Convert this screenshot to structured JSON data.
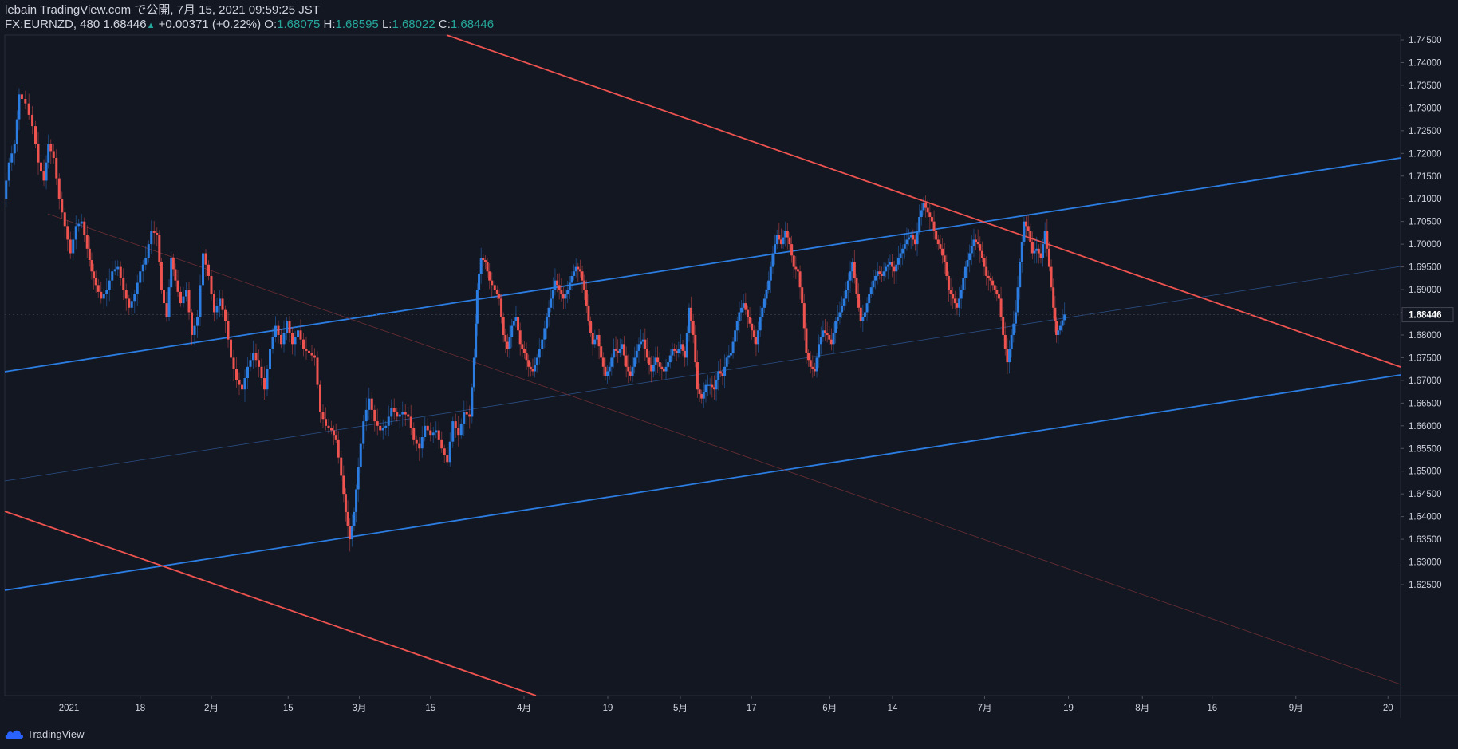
{
  "header": {
    "publisher": "lebain TradingView.com で公開, 7月 15, 2021 09:59:25 JST",
    "symbol": "FX:EURNZD, 480",
    "last": "1.68446",
    "change_arrow": "▲",
    "change": "+0.00371 (+0.22%)",
    "o_label": "O:",
    "o": "1.68075",
    "h_label": "H:",
    "h": "1.68595",
    "l_label": "L:",
    "l": "1.68022",
    "c_label": "C:",
    "c": "1.68446"
  },
  "footer": {
    "brand": "TradingView",
    "logo_icon": "tradingview-cloud-icon"
  },
  "colors": {
    "background": "#131722",
    "up": "#2b7de2",
    "down": "#ef5350",
    "blue_line": "#2b7de2",
    "red_line": "#ef5350",
    "axis_text": "#d1d4dc",
    "price_tag_bg": "#131722"
  },
  "chart_data": {
    "type": "candlestick",
    "ylim": [
      1.6225,
      1.7475
    ],
    "price_ticks": [
      "1.74500",
      "1.74000",
      "1.73500",
      "1.73000",
      "1.72500",
      "1.72000",
      "1.71500",
      "1.71000",
      "1.70500",
      "1.70000",
      "1.69500",
      "1.69000",
      "1.68500",
      "1.68000",
      "1.67500",
      "1.67000",
      "1.66500",
      "1.66000",
      "1.65500",
      "1.65000",
      "1.64500",
      "1.64000",
      "1.63500",
      "1.63000",
      "1.62500"
    ],
    "current_price": "1.68446",
    "x_ticks": [
      {
        "label": "2021",
        "t": 0.046
      },
      {
        "label": "18",
        "t": 0.097
      },
      {
        "label": "2月",
        "t": 0.148
      },
      {
        "label": "15",
        "t": 0.203
      },
      {
        "label": "3月",
        "t": 0.254
      },
      {
        "label": "15",
        "t": 0.305
      },
      {
        "label": "4月",
        "t": 0.372
      },
      {
        "label": "19",
        "t": 0.432
      },
      {
        "label": "5月",
        "t": 0.484
      },
      {
        "label": "17",
        "t": 0.535
      },
      {
        "label": "6月",
        "t": 0.591
      },
      {
        "label": "14",
        "t": 0.636
      },
      {
        "label": "7月",
        "t": 0.702
      },
      {
        "label": "19",
        "t": 0.762
      },
      {
        "label": "8月",
        "t": 0.815
      },
      {
        "label": "16",
        "t": 0.865
      },
      {
        "label": "9月",
        "t": 0.925
      },
      {
        "label": "20",
        "t": 0.991
      }
    ],
    "price_path": [
      [
        0,
        1.71
      ],
      [
        0.004,
        1.718
      ],
      [
        0.008,
        1.722
      ],
      [
        0.011,
        1.733
      ],
      [
        0.016,
        1.731
      ],
      [
        0.021,
        1.726
      ],
      [
        0.025,
        1.718
      ],
      [
        0.029,
        1.714
      ],
      [
        0.032,
        1.722
      ],
      [
        0.036,
        1.719
      ],
      [
        0.04,
        1.71
      ],
      [
        0.044,
        1.704
      ],
      [
        0.048,
        1.698
      ],
      [
        0.052,
        1.704
      ],
      [
        0.056,
        1.705
      ],
      [
        0.06,
        1.699
      ],
      [
        0.063,
        1.694
      ],
      [
        0.066,
        1.691
      ],
      [
        0.07,
        1.688
      ],
      [
        0.074,
        1.69
      ],
      [
        0.078,
        1.694
      ],
      [
        0.082,
        1.695
      ],
      [
        0.086,
        1.69
      ],
      [
        0.09,
        1.686
      ],
      [
        0.094,
        1.689
      ],
      [
        0.098,
        1.694
      ],
      [
        0.102,
        1.697
      ],
      [
        0.106,
        1.703
      ],
      [
        0.11,
        1.702
      ],
      [
        0.113,
        1.69
      ],
      [
        0.117,
        1.684
      ],
      [
        0.12,
        1.697
      ],
      [
        0.123,
        1.692
      ],
      [
        0.127,
        1.687
      ],
      [
        0.131,
        1.69
      ],
      [
        0.135,
        1.68
      ],
      [
        0.139,
        1.684
      ],
      [
        0.143,
        1.698
      ],
      [
        0.147,
        1.693
      ],
      [
        0.151,
        1.685
      ],
      [
        0.155,
        1.688
      ],
      [
        0.159,
        1.683
      ],
      [
        0.163,
        1.675
      ],
      [
        0.167,
        1.67
      ],
      [
        0.171,
        1.668
      ],
      [
        0.175,
        1.673
      ],
      [
        0.179,
        1.676
      ],
      [
        0.183,
        1.673
      ],
      [
        0.187,
        1.668
      ],
      [
        0.191,
        1.677
      ],
      [
        0.195,
        1.682
      ],
      [
        0.199,
        1.678
      ],
      [
        0.203,
        1.683
      ],
      [
        0.207,
        1.678
      ],
      [
        0.211,
        1.681
      ],
      [
        0.215,
        1.677
      ],
      [
        0.219,
        1.676
      ],
      [
        0.223,
        1.675
      ],
      [
        0.227,
        1.663
      ],
      [
        0.231,
        1.66
      ],
      [
        0.235,
        1.659
      ],
      [
        0.238,
        1.657
      ],
      [
        0.242,
        1.649
      ],
      [
        0.245,
        1.641
      ],
      [
        0.248,
        1.635
      ],
      [
        0.251,
        1.641
      ],
      [
        0.254,
        1.651
      ],
      [
        0.258,
        1.661
      ],
      [
        0.262,
        1.666
      ],
      [
        0.266,
        1.661
      ],
      [
        0.27,
        1.659
      ],
      [
        0.274,
        1.66
      ],
      [
        0.278,
        1.664
      ],
      [
        0.282,
        1.662
      ],
      [
        0.286,
        1.663
      ],
      [
        0.29,
        1.662
      ],
      [
        0.294,
        1.657
      ],
      [
        0.298,
        1.655
      ],
      [
        0.302,
        1.66
      ],
      [
        0.306,
        1.658
      ],
      [
        0.31,
        1.659
      ],
      [
        0.314,
        1.655
      ],
      [
        0.318,
        1.652
      ],
      [
        0.322,
        1.661
      ],
      [
        0.326,
        1.658
      ],
      [
        0.33,
        1.663
      ],
      [
        0.334,
        1.662
      ],
      [
        0.337,
        1.675
      ],
      [
        0.339,
        1.69
      ],
      [
        0.342,
        1.697
      ],
      [
        0.345,
        1.696
      ],
      [
        0.348,
        1.692
      ],
      [
        0.352,
        1.69
      ],
      [
        0.355,
        1.688
      ],
      [
        0.358,
        1.68
      ],
      [
        0.361,
        1.677
      ],
      [
        0.364,
        1.682
      ],
      [
        0.367,
        1.684
      ],
      [
        0.37,
        1.678
      ],
      [
        0.373,
        1.676
      ],
      [
        0.376,
        1.673
      ],
      [
        0.379,
        1.672
      ],
      [
        0.382,
        1.675
      ],
      [
        0.386,
        1.679
      ],
      [
        0.389,
        1.684
      ],
      [
        0.392,
        1.688
      ],
      [
        0.395,
        1.692
      ],
      [
        0.398,
        1.69
      ],
      [
        0.401,
        1.688
      ],
      [
        0.404,
        1.69
      ],
      [
        0.407,
        1.693
      ],
      [
        0.41,
        1.695
      ],
      [
        0.413,
        1.694
      ],
      [
        0.416,
        1.69
      ],
      [
        0.419,
        1.683
      ],
      [
        0.422,
        1.678
      ],
      [
        0.425,
        1.68
      ],
      [
        0.428,
        1.675
      ],
      [
        0.431,
        1.671
      ],
      [
        0.434,
        1.673
      ],
      [
        0.437,
        1.677
      ],
      [
        0.44,
        1.676
      ],
      [
        0.443,
        1.678
      ],
      [
        0.446,
        1.673
      ],
      [
        0.449,
        1.671
      ],
      [
        0.452,
        1.675
      ],
      [
        0.455,
        1.678
      ],
      [
        0.458,
        1.679
      ],
      [
        0.461,
        1.675
      ],
      [
        0.464,
        1.672
      ],
      [
        0.467,
        1.675
      ],
      [
        0.47,
        1.673
      ],
      [
        0.473,
        1.672
      ],
      [
        0.476,
        1.674
      ],
      [
        0.479,
        1.677
      ],
      [
        0.482,
        1.676
      ],
      [
        0.485,
        1.678
      ],
      [
        0.488,
        1.675
      ],
      [
        0.491,
        1.686
      ],
      [
        0.494,
        1.68
      ],
      [
        0.497,
        1.668
      ],
      [
        0.5,
        1.666
      ],
      [
        0.503,
        1.669
      ],
      [
        0.506,
        1.669
      ],
      [
        0.509,
        1.668
      ],
      [
        0.512,
        1.672
      ],
      [
        0.515,
        1.671
      ],
      [
        0.518,
        1.675
      ],
      [
        0.521,
        1.676
      ],
      [
        0.524,
        1.681
      ],
      [
        0.527,
        1.685
      ],
      [
        0.53,
        1.687
      ],
      [
        0.533,
        1.684
      ],
      [
        0.536,
        1.681
      ],
      [
        0.539,
        1.678
      ],
      [
        0.542,
        1.684
      ],
      [
        0.545,
        1.688
      ],
      [
        0.548,
        1.692
      ],
      [
        0.551,
        1.698
      ],
      [
        0.554,
        1.702
      ],
      [
        0.557,
        1.7
      ],
      [
        0.56,
        1.703
      ],
      [
        0.563,
        1.7
      ],
      [
        0.566,
        1.695
      ],
      [
        0.569,
        1.694
      ],
      [
        0.572,
        1.687
      ],
      [
        0.575,
        1.676
      ],
      [
        0.578,
        1.673
      ],
      [
        0.581,
        1.672
      ],
      [
        0.584,
        1.678
      ],
      [
        0.587,
        1.681
      ],
      [
        0.59,
        1.68
      ],
      [
        0.593,
        1.678
      ],
      [
        0.596,
        1.683
      ],
      [
        0.599,
        1.685
      ],
      [
        0.602,
        1.688
      ],
      [
        0.605,
        1.692
      ],
      [
        0.608,
        1.696
      ],
      [
        0.611,
        1.689
      ],
      [
        0.614,
        1.683
      ],
      [
        0.617,
        1.685
      ],
      [
        0.62,
        1.689
      ],
      [
        0.623,
        1.692
      ],
      [
        0.626,
        1.694
      ],
      [
        0.629,
        1.693
      ],
      [
        0.632,
        1.695
      ],
      [
        0.635,
        1.696
      ],
      [
        0.638,
        1.694
      ],
      [
        0.641,
        1.697
      ],
      [
        0.644,
        1.699
      ],
      [
        0.647,
        1.701
      ],
      [
        0.65,
        1.702
      ],
      [
        0.653,
        1.7
      ],
      [
        0.656,
        1.706
      ],
      [
        0.659,
        1.709
      ],
      [
        0.662,
        1.707
      ],
      [
        0.665,
        1.705
      ],
      [
        0.668,
        1.701
      ],
      [
        0.671,
        1.699
      ],
      [
        0.674,
        1.696
      ],
      [
        0.677,
        1.69
      ],
      [
        0.68,
        1.688
      ],
      [
        0.683,
        1.686
      ],
      [
        0.686,
        1.69
      ],
      [
        0.689,
        1.695
      ],
      [
        0.692,
        1.698
      ],
      [
        0.695,
        1.701
      ],
      [
        0.698,
        1.7
      ],
      [
        0.701,
        1.697
      ],
      [
        0.704,
        1.693
      ],
      [
        0.707,
        1.692
      ],
      [
        0.71,
        1.69
      ],
      [
        0.713,
        1.688
      ],
      [
        0.716,
        1.68
      ],
      [
        0.719,
        1.674
      ],
      [
        0.722,
        1.68
      ],
      [
        0.725,
        1.685
      ],
      [
        0.728,
        1.696
      ],
      [
        0.731,
        1.705
      ],
      [
        0.734,
        1.703
      ],
      [
        0.737,
        1.698
      ],
      [
        0.74,
        1.699
      ],
      [
        0.743,
        1.697
      ],
      [
        0.746,
        1.703
      ],
      [
        0.749,
        1.695
      ],
      [
        0.752,
        1.686
      ],
      [
        0.754,
        1.68
      ],
      [
        0.757,
        1.682
      ],
      [
        0.76,
        1.6845
      ]
    ]
  }
}
